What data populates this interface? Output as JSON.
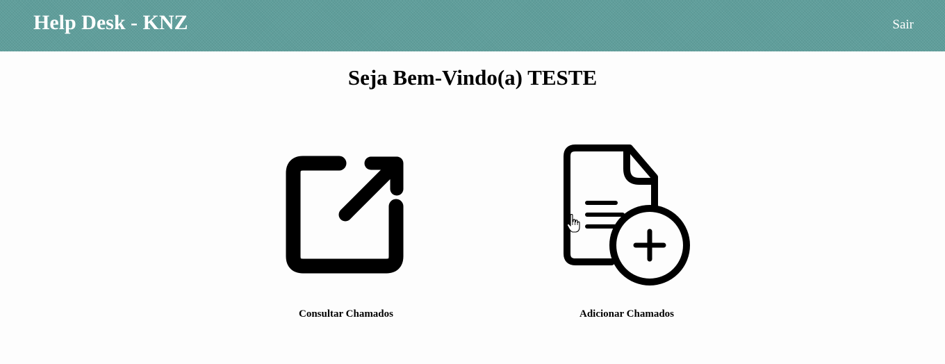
{
  "header": {
    "title": "Help Desk - KNZ",
    "logout_label": "Sair",
    "background_color": "#5f9e9b"
  },
  "main": {
    "welcome": "Seja Bem-Vindo(a) TESTE",
    "actions": [
      {
        "label": "Consultar Chamados",
        "icon": "external-link-icon"
      },
      {
        "label": "Adicionar Chamados",
        "icon": "file-add-icon"
      }
    ]
  },
  "cursor": {
    "icon": "hand-pointer-icon"
  }
}
